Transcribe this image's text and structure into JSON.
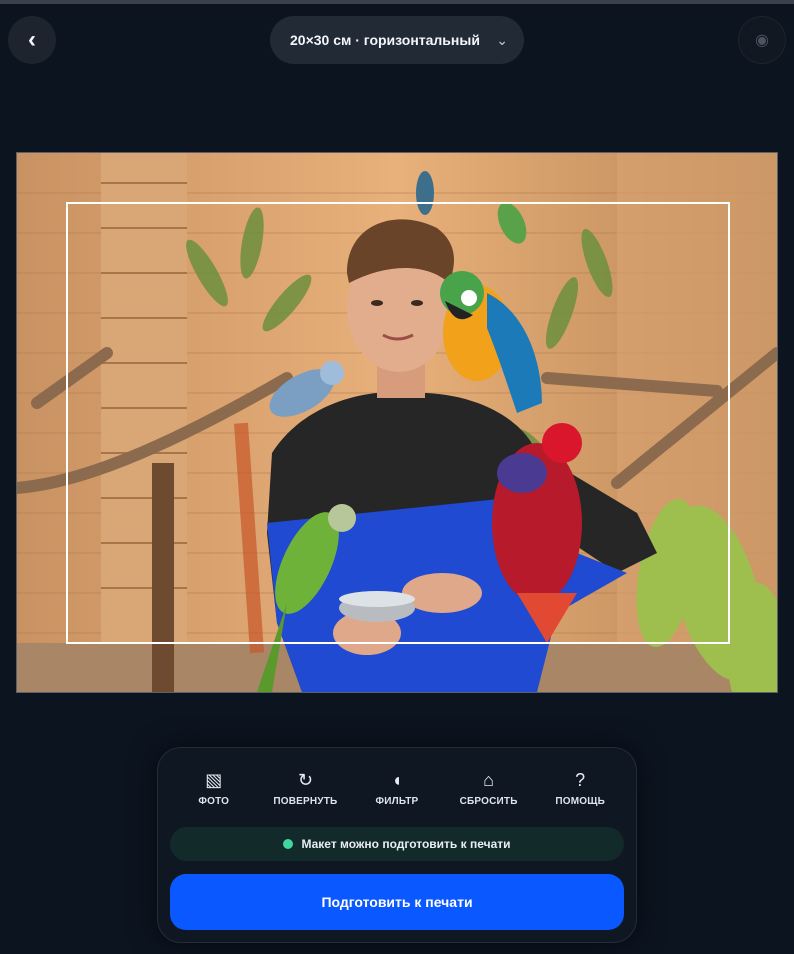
{
  "header": {
    "back_icon": "chevron-left-icon",
    "back_glyph": "‹",
    "size_label": "20×30 см · горизонтальный",
    "dropdown_glyph": "⌄",
    "camera_icon": "camera-icon",
    "camera_glyph": "◉"
  },
  "photo": {
    "subject": "photo-of-young-man-with-parrots",
    "crop_border_color": "#ffffff"
  },
  "toolbar": {
    "items": [
      {
        "icon": "photo-icon",
        "glyph": "▧",
        "label": "ФОТО"
      },
      {
        "icon": "rotate-icon",
        "glyph": "↻",
        "label": "ПОВЕРНУТЬ"
      },
      {
        "icon": "filter-icon",
        "glyph": "◖",
        "label": "ФИЛЬТР"
      },
      {
        "icon": "home-reset-icon",
        "glyph": "⌂",
        "label": "СБРОСИТЬ"
      },
      {
        "icon": "help-icon",
        "glyph": "?",
        "label": "ПОМОЩЬ"
      }
    ]
  },
  "status": {
    "text": "Макет можно подготовить к печати",
    "color": "#3fd6a0"
  },
  "action": {
    "label": "Подготовить к печати",
    "color": "#0a58ff"
  }
}
